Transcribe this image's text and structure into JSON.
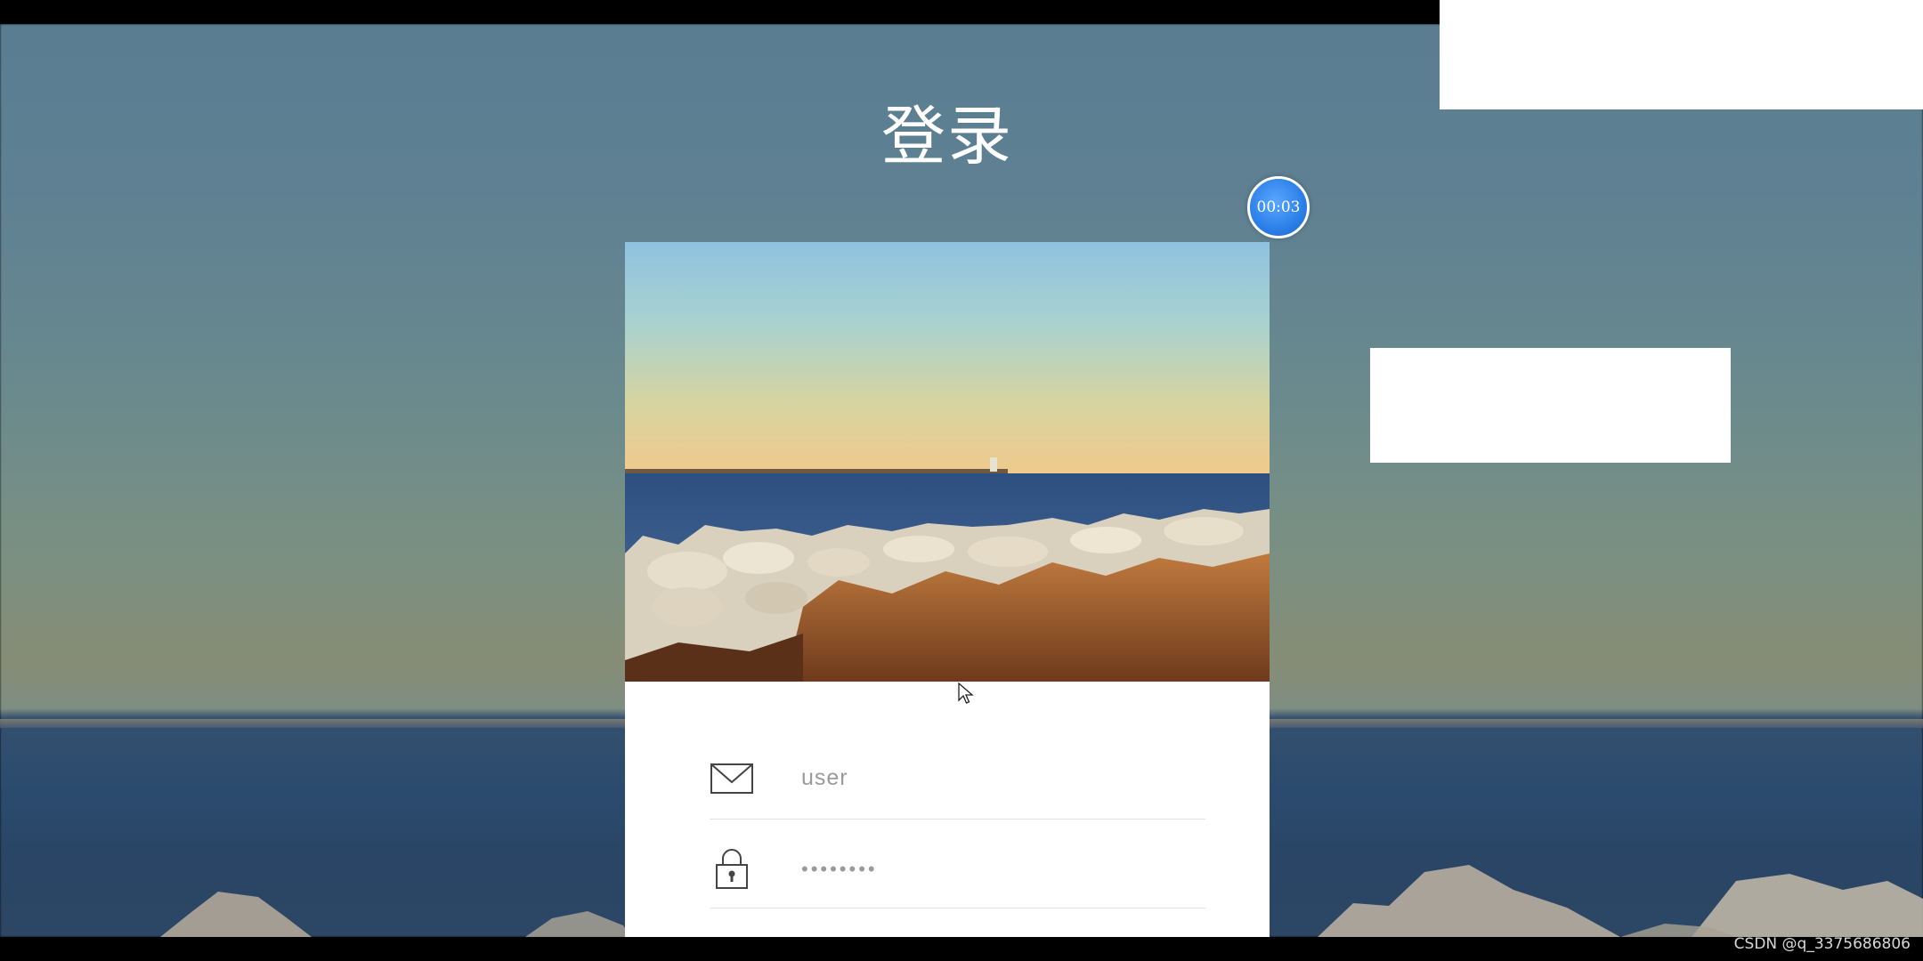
{
  "page": {
    "title": "登录",
    "timer": "00:03"
  },
  "login_form": {
    "username_value": "user",
    "password_value": "••••••••"
  },
  "watermark": "CSDN @q_3375686806",
  "icons": {
    "username": "mail-icon",
    "password": "lock-icon",
    "pointer": "mouse-cursor-icon"
  },
  "colors": {
    "timer_blue": "#2b7fe8",
    "card_background": "#ffffff",
    "title_text": "#ffffff",
    "field_text": "#9a9a9a"
  }
}
